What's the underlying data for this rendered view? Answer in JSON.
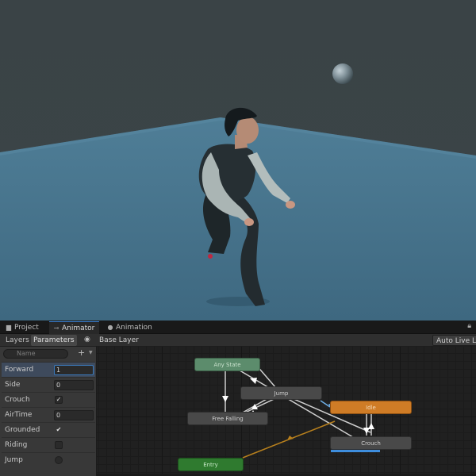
{
  "tabs": [
    {
      "label": "Project",
      "icon": "folder-icon"
    },
    {
      "label": "Animator",
      "icon": "animator-icon"
    },
    {
      "label": "Animation",
      "icon": "animation-clock-icon"
    }
  ],
  "toolbar": {
    "layers_label": "Layers",
    "parameters_label": "Parameters",
    "breadcrumb": "Base Layer",
    "auto_live_label": "Auto Live Lin"
  },
  "parameters": {
    "search_placeholder": "Name",
    "items": [
      {
        "name": "Forward",
        "type": "float",
        "value": "1"
      },
      {
        "name": "Side",
        "type": "float",
        "value": "0"
      },
      {
        "name": "Crouch",
        "type": "bool",
        "value": "✓"
      },
      {
        "name": "AirTime",
        "type": "float",
        "value": "0"
      },
      {
        "name": "Grounded",
        "type": "bool",
        "value": "✔"
      },
      {
        "name": "Riding",
        "type": "bool",
        "value": ""
      },
      {
        "name": "Jump",
        "type": "trigger",
        "value": ""
      }
    ]
  },
  "graph": {
    "states": {
      "any_state": "Any State",
      "jump": "Jump",
      "free_falling": "Free Falling",
      "idle": "Idle",
      "crouch": "Crouch",
      "entry": "Entry"
    },
    "crouch_progress": 0.6
  },
  "colors": {
    "accent": "#3e8ede",
    "default_state": "#cf7c26",
    "any_state": "#5c8c6c",
    "entry": "#2f7a2f",
    "active_transition": "#6fb0e8",
    "entry_transition": "#b8801d"
  }
}
